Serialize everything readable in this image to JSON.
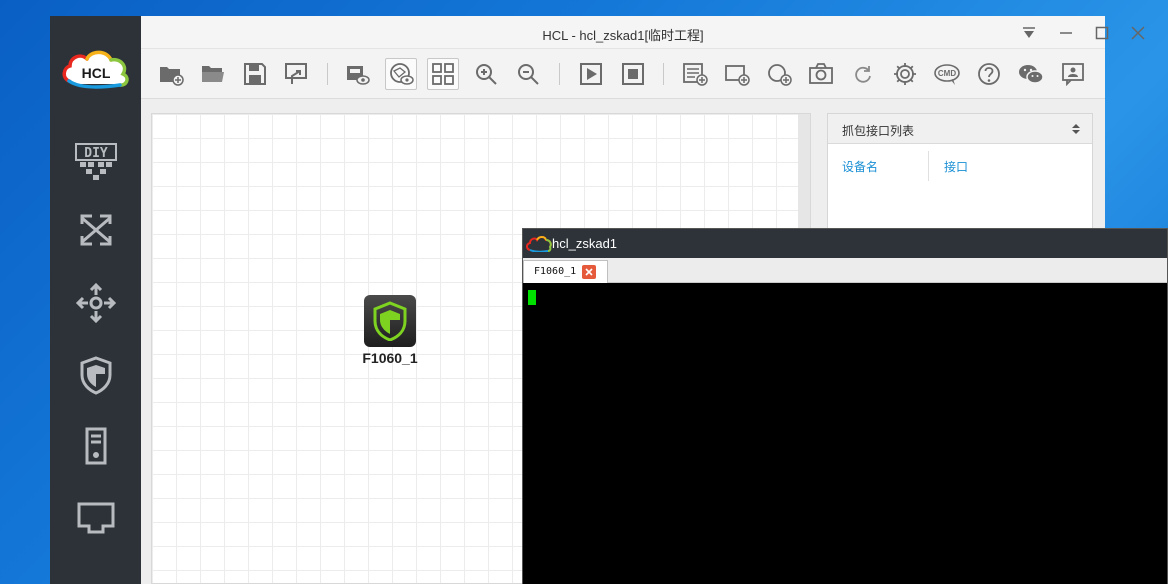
{
  "app": {
    "logo_text": "HCL",
    "title": "HCL - hcl_zskad1[临时工程]"
  },
  "sidebar": {
    "items": [
      {
        "name": "diy",
        "icon": "diy-icon"
      },
      {
        "name": "switch",
        "icon": "switch-icon"
      },
      {
        "name": "router",
        "icon": "router-icon"
      },
      {
        "name": "firewall",
        "icon": "shield-icon"
      },
      {
        "name": "server",
        "icon": "server-icon"
      },
      {
        "name": "network-port",
        "icon": "ethernet-port-icon"
      }
    ]
  },
  "window_controls": [
    "dropdown-icon",
    "minimize-icon",
    "maximize-icon",
    "close-icon"
  ],
  "toolbar": {
    "buttons": [
      "new-project-icon",
      "open-folder-icon",
      "save-icon",
      "export-icon",
      "screenshot-view-icon",
      "topology-view-icon",
      "grid-view-icon",
      "zoom-in-icon",
      "zoom-out-icon",
      "start-icon",
      "stop-icon",
      "add-list-icon",
      "add-rectangle-icon",
      "add-circle-icon",
      "camera-icon",
      "refresh-icon",
      "settings-icon",
      "cmd-icon",
      "help-icon",
      "wechat-icon",
      "feedback-icon"
    ],
    "cmd_label": "CMD"
  },
  "canvas": {
    "device": {
      "label": "F1060_1",
      "icon": "firewall-device-icon"
    }
  },
  "capture_panel": {
    "title": "抓包接口列表",
    "columns": [
      "设备名",
      "接口"
    ]
  },
  "terminal": {
    "title": "hcl_zskad1",
    "tab_label": "F1060_1",
    "colors": {
      "cursor": "#00e000",
      "background": "#000000",
      "tab_close": "#e65a3c"
    }
  }
}
